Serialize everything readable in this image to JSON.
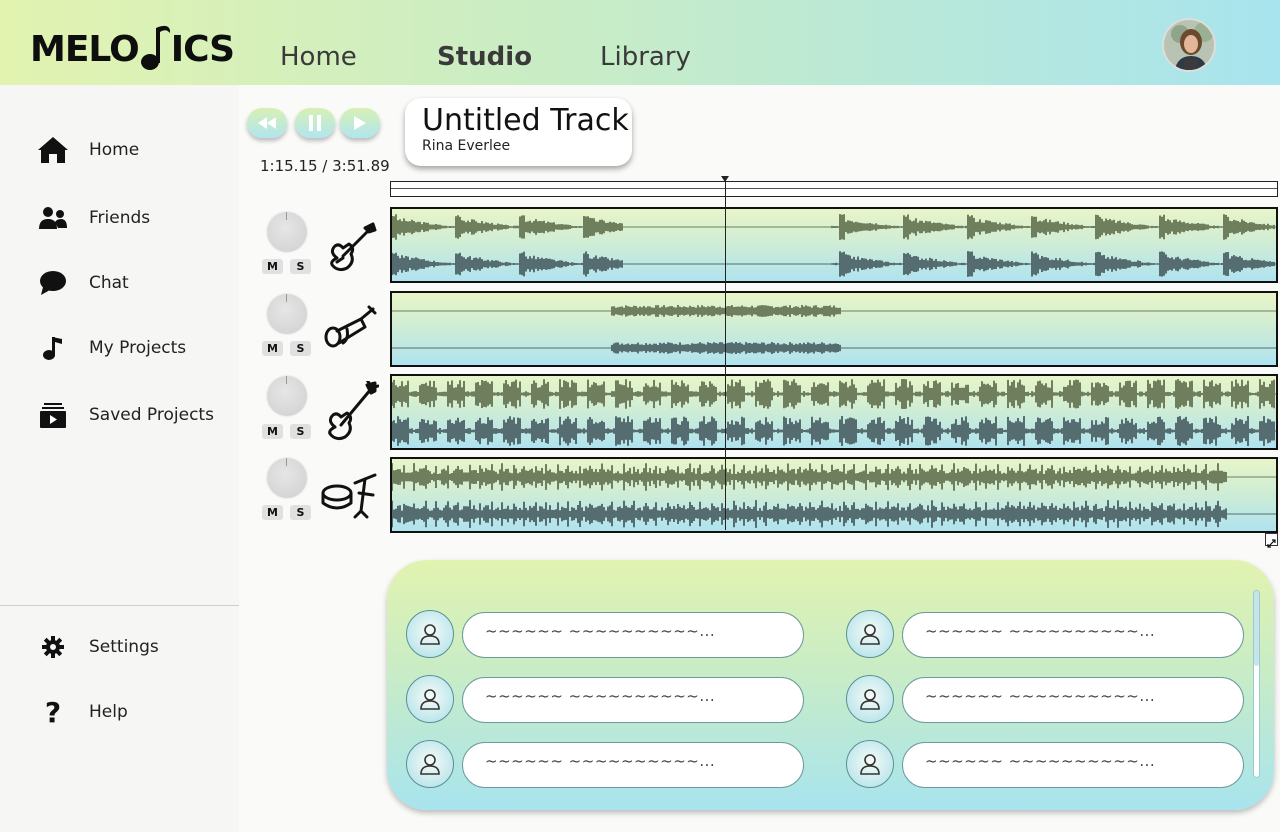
{
  "app": {
    "brand": "MELODICS",
    "brand_pre": "MELO",
    "brand_post": "ICS"
  },
  "topnav": {
    "home": "Home",
    "studio": "Studio",
    "library": "Library",
    "active": "Studio"
  },
  "sidebar": {
    "items": [
      {
        "label": "Home",
        "icon": "home-icon"
      },
      {
        "label": "Friends",
        "icon": "friends-icon"
      },
      {
        "label": "Chat",
        "icon": "chat-icon"
      },
      {
        "label": "My Projects",
        "icon": "music-note-icon"
      },
      {
        "label": "Saved Projects",
        "icon": "saved-projects-icon"
      }
    ],
    "bottom": [
      {
        "label": "Settings",
        "icon": "gear-icon"
      },
      {
        "label": "Help",
        "icon": "help-icon"
      }
    ]
  },
  "transport": {
    "rewind": "rewind-icon",
    "pause": "pause-icon",
    "play": "play-icon",
    "time": "1:15.15 / 3:51.89"
  },
  "track_info": {
    "title": "Untitled Track",
    "artist": "Rina Everlee"
  },
  "tracks": [
    {
      "instrument": "electric-guitar-icon",
      "mute": "M",
      "solo": "S"
    },
    {
      "instrument": "trumpet-icon",
      "mute": "M",
      "solo": "S"
    },
    {
      "instrument": "bass-guitar-icon",
      "mute": "M",
      "solo": "S"
    },
    {
      "instrument": "drums-icon",
      "mute": "M",
      "solo": "S"
    }
  ],
  "chat": {
    "messages": [
      {
        "text": "~~~~~~ ~~~~~~~~~~..."
      },
      {
        "text": "~~~~~~ ~~~~~~~~~~..."
      },
      {
        "text": "~~~~~~ ~~~~~~~~~~..."
      },
      {
        "text": "~~~~~~ ~~~~~~~~~~..."
      },
      {
        "text": "~~~~~~ ~~~~~~~~~~..."
      },
      {
        "text": "~~~~~~ ~~~~~~~~~~..."
      }
    ]
  },
  "colors": {
    "gradient_start": "#e2f3b0",
    "gradient_end": "#a8e4ee",
    "waveform_top": "#6f7f5e",
    "waveform_bottom": "#556d70"
  }
}
